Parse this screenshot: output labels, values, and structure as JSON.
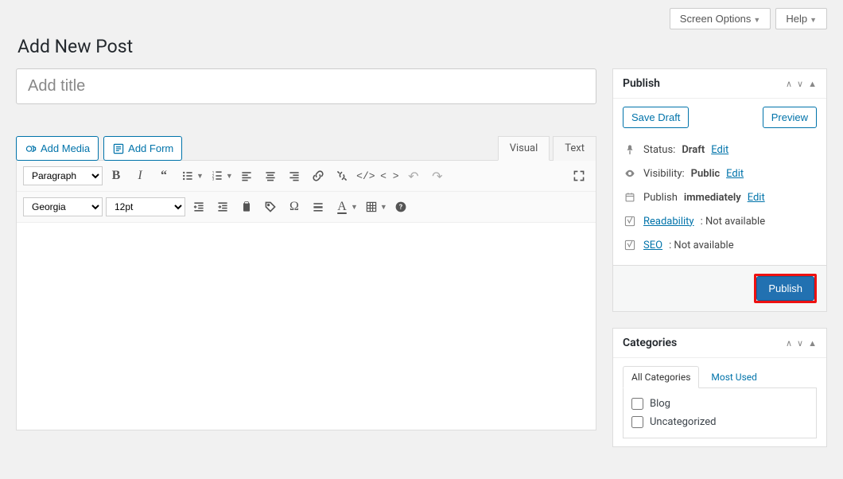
{
  "topbar": {
    "screen_options": "Screen Options",
    "help": "Help"
  },
  "page_title": "Add New Post",
  "title_placeholder": "Add title",
  "media": {
    "add_media": "Add Media",
    "add_form": "Add Form"
  },
  "editor_tabs": {
    "visual": "Visual",
    "text": "Text"
  },
  "toolbar": {
    "format_select": "Paragraph",
    "font_family": "Georgia",
    "font_size": "12pt"
  },
  "publish": {
    "heading": "Publish",
    "save_draft": "Save Draft",
    "preview": "Preview",
    "status_label": "Status:",
    "status_value": "Draft",
    "visibility_label": "Visibility:",
    "visibility_value": "Public",
    "publish_label": "Publish",
    "publish_value": "immediately",
    "readability_label": "Readability",
    "readability_value": ": Not available",
    "seo_label": "SEO",
    "seo_value": ": Not available",
    "edit": "Edit",
    "publish_button": "Publish"
  },
  "categories": {
    "heading": "Categories",
    "tab_all": "All Categories",
    "tab_most": "Most Used",
    "items": [
      "Blog",
      "Uncategorized"
    ]
  }
}
